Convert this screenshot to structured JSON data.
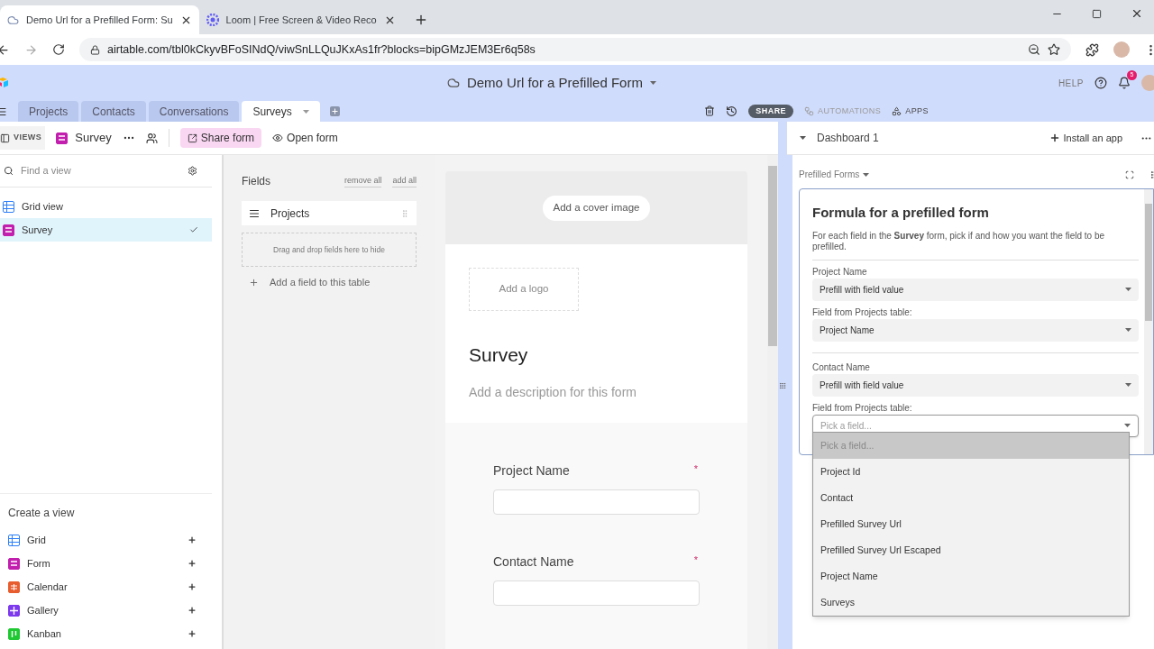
{
  "browser": {
    "tabs": [
      {
        "title": "Demo Url for a Prefilled Form: Su",
        "selected": true
      },
      {
        "title": "Loom | Free Screen & Video Reco",
        "selected": false
      }
    ],
    "url": "airtable.com/tbl0kCkyvBFoSINdQ/viwSnLLQuJKxAs1fr?blocks=bipGMzJEM3Er6q58s"
  },
  "header": {
    "base_title": "Demo Url for a Prefilled Form",
    "help": "HELP",
    "notification_count": "5"
  },
  "table_tabs": [
    {
      "label": "Projects",
      "selected": false
    },
    {
      "label": "Contacts",
      "selected": false
    },
    {
      "label": "Conversations",
      "selected": false
    },
    {
      "label": "Surveys",
      "selected": true
    }
  ],
  "toolbar": {
    "share": "SHARE",
    "automations": "AUTOMATIONS",
    "apps": "APPS"
  },
  "view_bar": {
    "views": "VIEWS",
    "view_name": "Survey",
    "share_form": "Share form",
    "open_form": "Open form"
  },
  "sidebar": {
    "search_placeholder": "Find a view",
    "views": [
      {
        "label": "Grid view",
        "kind": "grid",
        "selected": false
      },
      {
        "label": "Survey",
        "kind": "form",
        "selected": true
      }
    ],
    "create_title": "Create a view",
    "create_items": [
      {
        "label": "Grid",
        "kind": "grid"
      },
      {
        "label": "Form",
        "kind": "form"
      },
      {
        "label": "Calendar",
        "kind": "calendar"
      },
      {
        "label": "Gallery",
        "kind": "gallery"
      },
      {
        "label": "Kanban",
        "kind": "kanban"
      }
    ]
  },
  "fields_panel": {
    "title": "Fields",
    "remove_all": "remove all",
    "add_all": "add all",
    "fields": [
      "Projects"
    ],
    "drop_hint": "Drag and drop fields here to hide",
    "add_field": "Add a field to this table"
  },
  "form": {
    "cover": "Add a cover image",
    "logo": "Add a logo",
    "title": "Survey",
    "description": "Add a description for this form",
    "questions": [
      {
        "label": "Project Name",
        "required_mark": "*"
      },
      {
        "label": "Contact Name",
        "required_mark": "*"
      }
    ]
  },
  "dashboard": {
    "title": "Dashboard 1",
    "install": "Install an app",
    "app_name": "Prefilled Forms",
    "heading": "Formula for a prefilled form",
    "description": "For each field in the **Survey** form, pick if and how you want the field to be prefilled.",
    "sections": [
      {
        "label": "Project Name",
        "mode": "Prefill with field value",
        "field_label": "Field from Projects table:",
        "value": "Project Name",
        "focused": false
      },
      {
        "label": "Contact Name",
        "mode": "Prefill with field value",
        "field_label": "Field from Projects table:",
        "placeholder": "Pick a field...",
        "focused": true
      }
    ],
    "options": [
      {
        "label": "Pick a field...",
        "selected": true
      },
      {
        "label": "Project Id",
        "selected": false
      },
      {
        "label": "Contact",
        "selected": false
      },
      {
        "label": "Prefilled Survey Url",
        "selected": false
      },
      {
        "label": "Prefilled Survey Url Escaped",
        "selected": false
      },
      {
        "label": "Project Name",
        "selected": false
      },
      {
        "label": "Surveys",
        "selected": false
      }
    ]
  }
}
